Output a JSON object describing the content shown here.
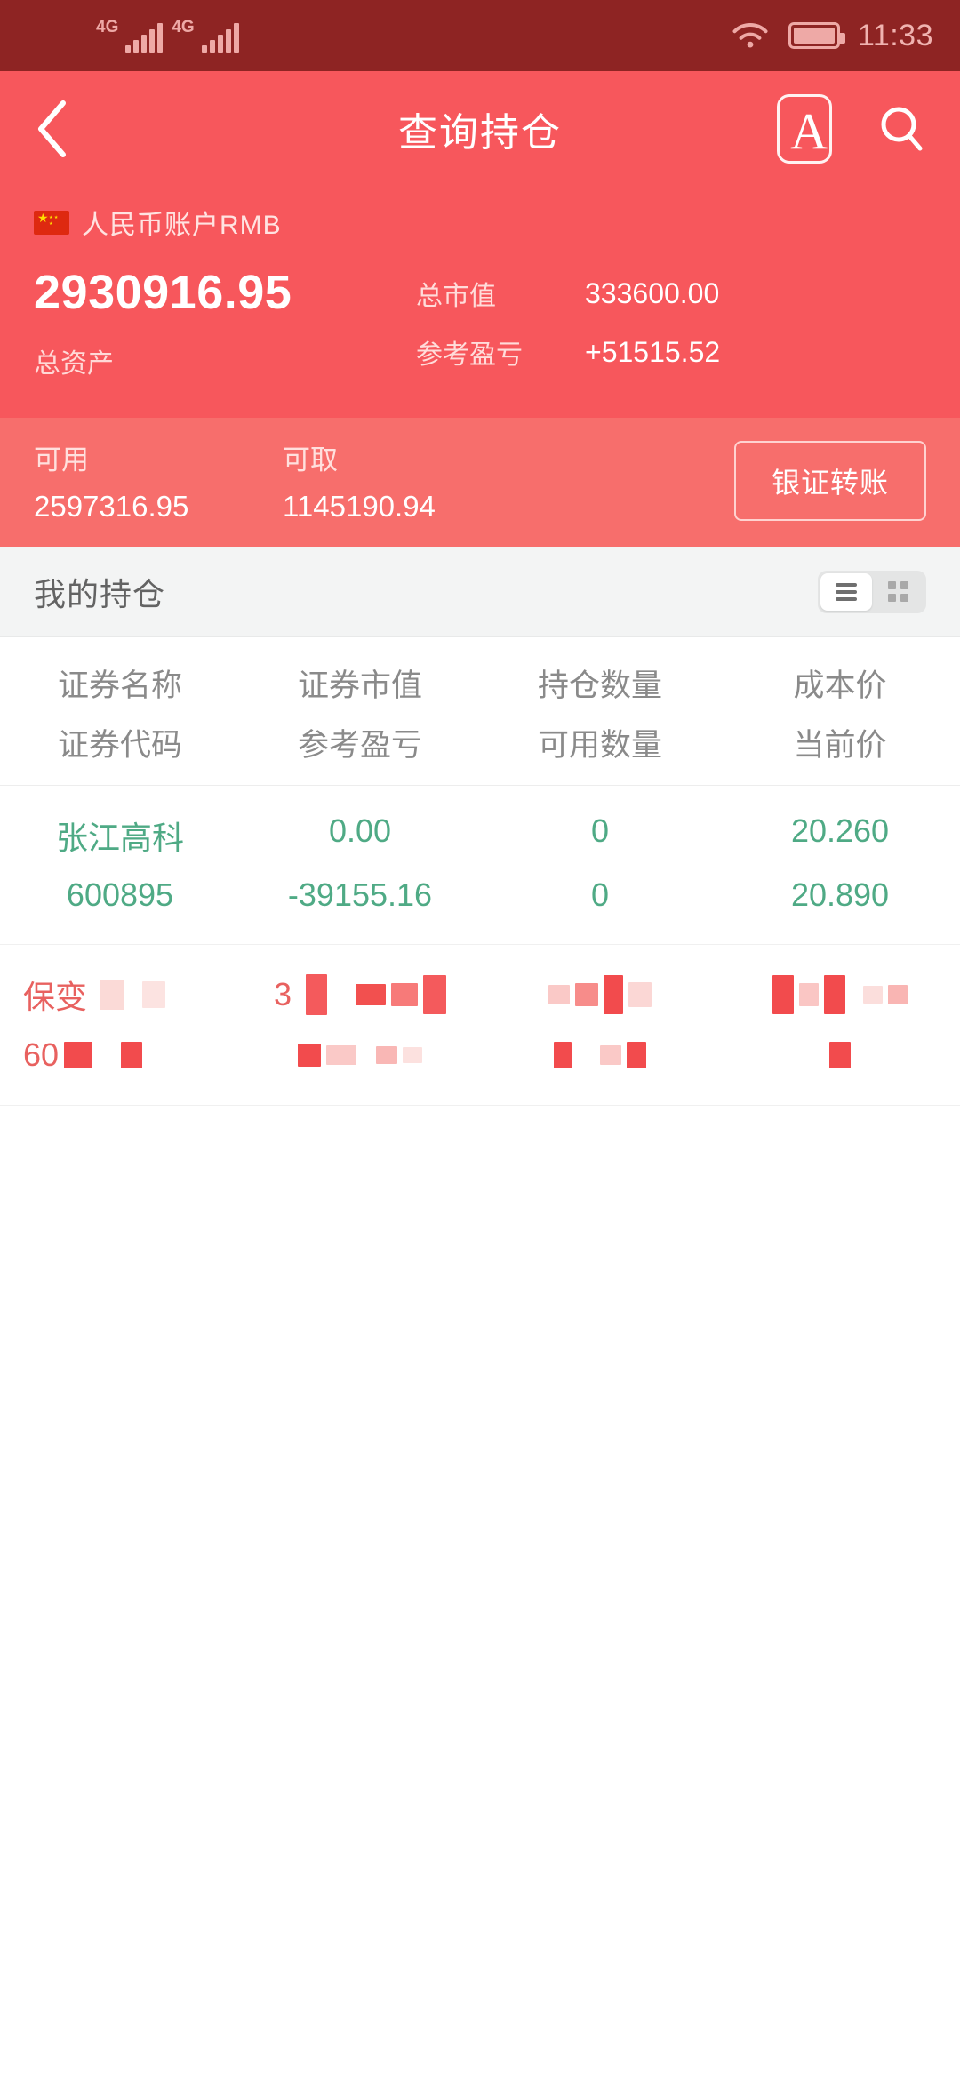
{
  "status_bar": {
    "network_1": "4G",
    "network_2": "4G",
    "wifi_icon": "wifi-icon",
    "battery_icon": "battery-icon",
    "time": "11:33"
  },
  "app_bar": {
    "back_icon": "chevron-left-icon",
    "title": "查询持仓",
    "font_size_icon": "font-size-icon",
    "font_size_letter": "A",
    "search_icon": "search-icon"
  },
  "account": {
    "flag_icon": "china-flag-icon",
    "name": "人民币账户RMB",
    "total_assets_value": "2930916.95",
    "total_assets_label": "总资产",
    "stats": [
      {
        "label": "总市值",
        "value": "333600.00"
      },
      {
        "label": "参考盈亏",
        "value": "+51515.52"
      }
    ]
  },
  "available": {
    "columns": [
      {
        "label": "可用",
        "value": "2597316.95"
      },
      {
        "label": "可取",
        "value": "1145190.94"
      }
    ],
    "transfer_button": "银证转账"
  },
  "positions": {
    "section_title": "我的持仓",
    "view_toggle": {
      "list_icon": "list-view-icon",
      "grid_icon": "grid-view-icon",
      "active": "list"
    },
    "headers": {
      "top": [
        "证券名称",
        "证券市值",
        "持仓数量",
        "成本价"
      ],
      "bottom": [
        "证券代码",
        "参考盈亏",
        "可用数量",
        "当前价"
      ]
    },
    "rows": [
      {
        "name": "张江高科",
        "code": "600895",
        "market_value": "0.00",
        "profit_loss": "-39155.16",
        "quantity": "0",
        "available_qty": "0",
        "cost_price": "20.260",
        "current_price": "20.890",
        "color": "#4FAA85",
        "censored": false
      },
      {
        "name": "保变",
        "code": "60",
        "market_value": "3",
        "profit_loss": "",
        "quantity": "",
        "available_qty": "",
        "cost_price": "",
        "current_price": "",
        "color": "#E8615F",
        "censored": true
      }
    ]
  },
  "colors": {
    "status_bar_bg": "#8E2423",
    "app_bar_bg": "#F7575C",
    "available_bg": "#F76E6C",
    "section_bg": "#F3F4F4",
    "gain_green": "#4FAA85",
    "loss_red": "#E8615F"
  }
}
